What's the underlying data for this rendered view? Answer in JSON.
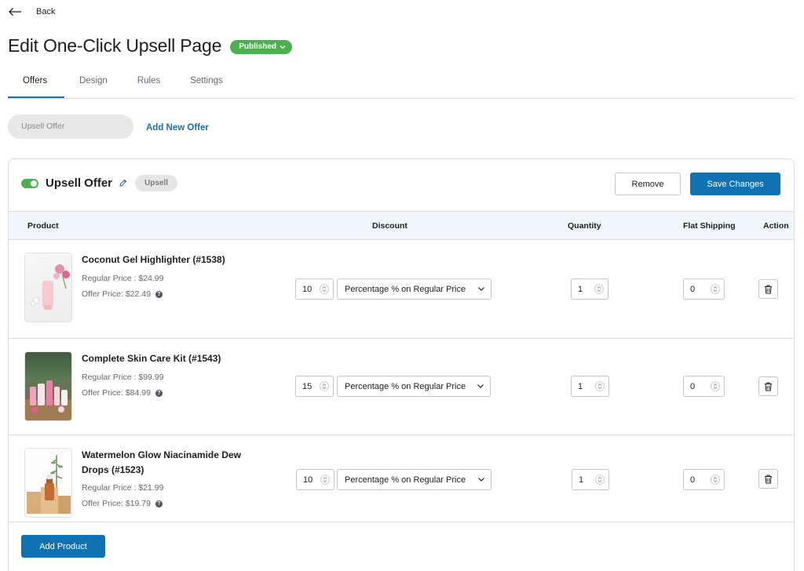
{
  "header": {
    "back_label": "Back",
    "title": "Edit One-Click Upsell Page",
    "status": "Published"
  },
  "tabs": [
    {
      "label": "Offers",
      "active": true
    },
    {
      "label": "Design",
      "active": false
    },
    {
      "label": "Rules",
      "active": false
    },
    {
      "label": "Settings",
      "active": false
    }
  ],
  "offers_bar": {
    "offer_pill": "Upsell Offer",
    "add_new_offer": "Add New Offer"
  },
  "offer_card": {
    "name": "Upsell Offer",
    "enabled": true,
    "type_badge": "Upsell",
    "remove_label": "Remove",
    "save_label": "Save Changes",
    "add_product_label": "Add Product"
  },
  "table": {
    "columns": [
      "Product",
      "Discount",
      "Quantity",
      "Flat Shipping",
      "Action"
    ],
    "rows": [
      {
        "name": "Coconut Gel Highlighter (#1538)",
        "regular_price": "Regular Price : $24.99",
        "offer_price": "Offer Price: $22.49",
        "discount_value": "10",
        "discount_type": "Percentage % on Regular Price",
        "quantity": "1",
        "flat_shipping": "0"
      },
      {
        "name": "Complete Skin Care Kit (#1543)",
        "regular_price": "Regular Price : $99.99",
        "offer_price": "Offer Price: $84.99",
        "discount_value": "15",
        "discount_type": "Percentage % on Regular Price",
        "quantity": "1",
        "flat_shipping": "0"
      },
      {
        "name": "Watermelon Glow Niacinamide Dew Drops (#1523)",
        "regular_price": "Regular Price : $21.99",
        "offer_price": "Offer Price: $19.79",
        "discount_value": "10",
        "discount_type": "Percentage % on Regular Price",
        "quantity": "1",
        "flat_shipping": "0"
      }
    ]
  },
  "colors": {
    "accent": "#1072b3",
    "link": "#1c6fab",
    "status_green": "#4caf50",
    "header_bg": "#f0f6fc"
  },
  "icons": {
    "back": "arrow-left-icon",
    "edit": "pencil-icon",
    "delete": "trash-icon",
    "help": "question-circle-icon",
    "dropdown": "chevron-down-icon"
  }
}
